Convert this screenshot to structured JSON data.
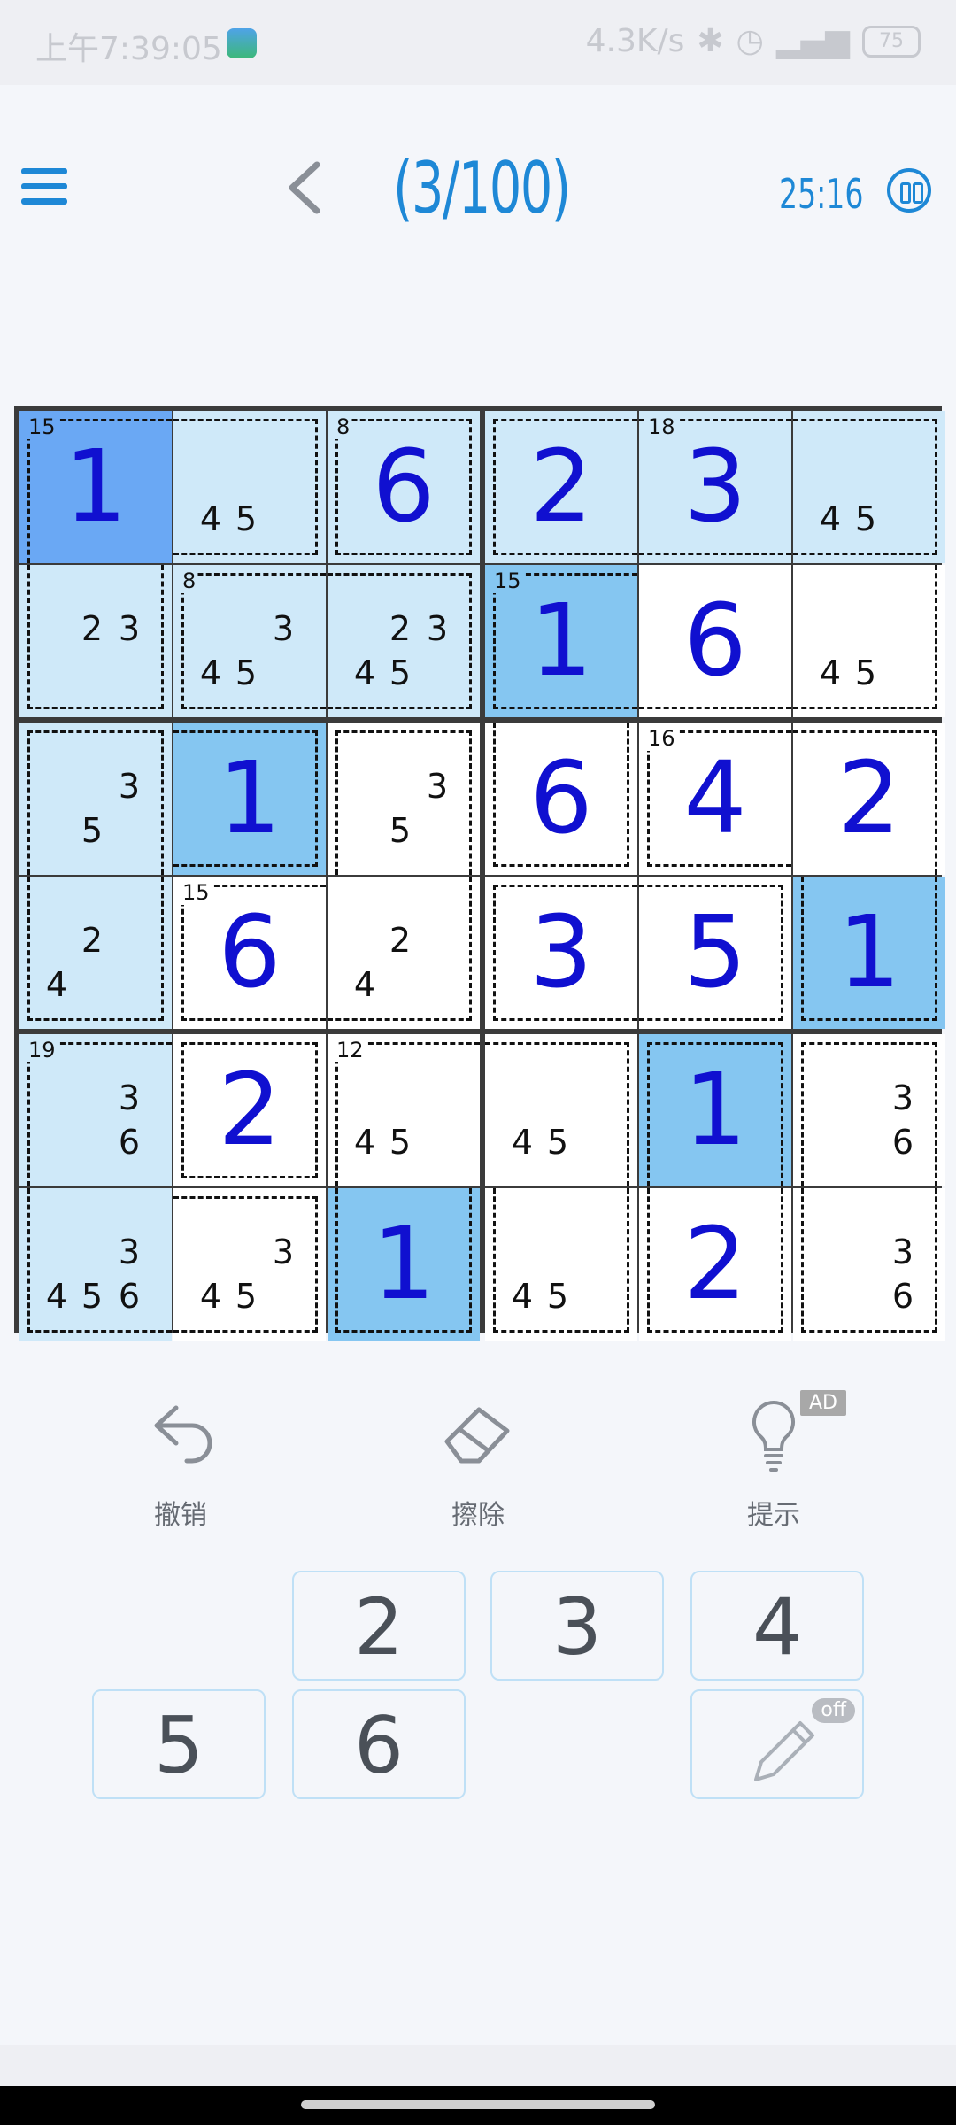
{
  "status_bar": {
    "time": "上午7:39:05",
    "speed": "4.3K/s",
    "battery": "75"
  },
  "header": {
    "puzzle_count": "(3/100)",
    "timer": "25:16"
  },
  "board": {
    "cells": [
      {
        "r": 0,
        "c": 0,
        "bg": "#6aa8f4",
        "val": "1",
        "sum": "15",
        "cage": "nr nb"
      },
      {
        "r": 0,
        "c": 1,
        "bg": "#cfe9f9",
        "notes": [
          "4",
          "5"
        ],
        "cage": "nl"
      },
      {
        "r": 0,
        "c": 2,
        "bg": "#cfe9f9",
        "val": "6",
        "sum": "8",
        "cage": ""
      },
      {
        "r": 0,
        "c": 3,
        "bg": "#cfe9f9",
        "val": "2",
        "cage": "nr"
      },
      {
        "r": 0,
        "c": 4,
        "bg": "#cfe9f9",
        "val": "3",
        "sum": "18",
        "cage": "nl nr"
      },
      {
        "r": 0,
        "c": 5,
        "bg": "#cfe9f9",
        "notes": [
          "4",
          "5"
        ],
        "cage": "nl"
      },
      {
        "r": 1,
        "c": 0,
        "bg": "#cfe9f9",
        "notes": [
          "2",
          "3"
        ],
        "cage": "nt"
      },
      {
        "r": 1,
        "c": 1,
        "bg": "#cfe9f9",
        "notes": [
          "3",
          "4",
          "5"
        ],
        "sum": "8",
        "cage": "nr"
      },
      {
        "r": 1,
        "c": 2,
        "bg": "#cfe9f9",
        "notes": [
          "2",
          "3",
          "4",
          "5"
        ],
        "cage": "nl"
      },
      {
        "r": 1,
        "c": 3,
        "bg": "#85c6f1",
        "val": "1",
        "sum": "15",
        "cage": "nr"
      },
      {
        "r": 1,
        "c": 4,
        "bg": "#ffffff",
        "val": "6",
        "cage": "nl nr nt"
      },
      {
        "r": 1,
        "c": 5,
        "bg": "#ffffff",
        "notes": [
          "4",
          "5"
        ],
        "cage": "nl nt"
      },
      {
        "r": 2,
        "c": 0,
        "bg": "#cfe9f9",
        "notes": [
          "3",
          "5"
        ],
        "cage": "nb"
      },
      {
        "r": 2,
        "c": 1,
        "bg": "#85c6f1",
        "val": "1",
        "cage": "nl"
      },
      {
        "r": 2,
        "c": 2,
        "bg": "#ffffff",
        "notes": [
          "3",
          "5"
        ],
        "cage": "nb"
      },
      {
        "r": 2,
        "c": 3,
        "bg": "#ffffff",
        "val": "6",
        "cage": "nt"
      },
      {
        "r": 2,
        "c": 4,
        "bg": "#ffffff",
        "val": "4",
        "sum": "16",
        "cage": "nr"
      },
      {
        "r": 2,
        "c": 5,
        "bg": "#ffffff",
        "val": "2",
        "cage": "nl nb"
      },
      {
        "r": 3,
        "c": 0,
        "bg": "#cfe9f9",
        "notes": [
          "2",
          "4"
        ],
        "cage": "nt"
      },
      {
        "r": 3,
        "c": 1,
        "bg": "#ffffff",
        "val": "6",
        "sum": "15",
        "cage": "nr"
      },
      {
        "r": 3,
        "c": 2,
        "bg": "#ffffff",
        "notes": [
          "2",
          "4"
        ],
        "cage": "nt nl"
      },
      {
        "r": 3,
        "c": 3,
        "bg": "#ffffff",
        "val": "3",
        "cage": "nr"
      },
      {
        "r": 3,
        "c": 4,
        "bg": "#ffffff",
        "val": "5",
        "cage": "nl"
      },
      {
        "r": 3,
        "c": 5,
        "bg": "#85c6f1",
        "val": "1",
        "cage": "nt"
      },
      {
        "r": 4,
        "c": 0,
        "bg": "#cfe9f9",
        "notes": [
          "3",
          "6"
        ],
        "sum": "19",
        "cage": "nr nb"
      },
      {
        "r": 4,
        "c": 1,
        "bg": "#ffffff",
        "val": "2",
        "cage": ""
      },
      {
        "r": 4,
        "c": 2,
        "bg": "#ffffff",
        "notes": [
          "4",
          "5"
        ],
        "sum": "12",
        "cage": "nr nb"
      },
      {
        "r": 4,
        "c": 3,
        "bg": "#ffffff",
        "notes": [
          "4",
          "5"
        ],
        "cage": "nl nb"
      },
      {
        "r": 4,
        "c": 4,
        "bg": "#85c6f1",
        "val": "1",
        "cage": "nb"
      },
      {
        "r": 4,
        "c": 5,
        "bg": "#ffffff",
        "notes": [
          "3",
          "6"
        ],
        "cage": "nb"
      },
      {
        "r": 5,
        "c": 0,
        "bg": "#cfe9f9",
        "notes": [
          "3",
          "4",
          "5",
          "6"
        ],
        "cage": "nt nr"
      },
      {
        "r": 5,
        "c": 1,
        "bg": "#ffffff",
        "notes": [
          "3",
          "4",
          "5"
        ],
        "cage": "nl"
      },
      {
        "r": 5,
        "c": 2,
        "bg": "#85c6f1",
        "val": "1",
        "cage": "nt"
      },
      {
        "r": 5,
        "c": 3,
        "bg": "#ffffff",
        "notes": [
          "4",
          "5"
        ],
        "cage": "nt"
      },
      {
        "r": 5,
        "c": 4,
        "bg": "#ffffff",
        "val": "2",
        "cage": "nt"
      },
      {
        "r": 5,
        "c": 5,
        "bg": "#ffffff",
        "notes": [
          "3",
          "6"
        ],
        "cage": "nt"
      }
    ]
  },
  "tools": {
    "undo": "撤销",
    "erase": "擦除",
    "hint": "提示",
    "ad_badge": "AD"
  },
  "number_pad": {
    "k2": "2",
    "k3": "3",
    "k4": "4",
    "k5": "5",
    "k6": "6",
    "pencil_state": "off"
  },
  "colors": {
    "accent": "#1e88d6",
    "digit": "#1010d0",
    "selected": "#6aa8f4",
    "highlight": "#85c6f1",
    "related": "#cfe9f9"
  }
}
